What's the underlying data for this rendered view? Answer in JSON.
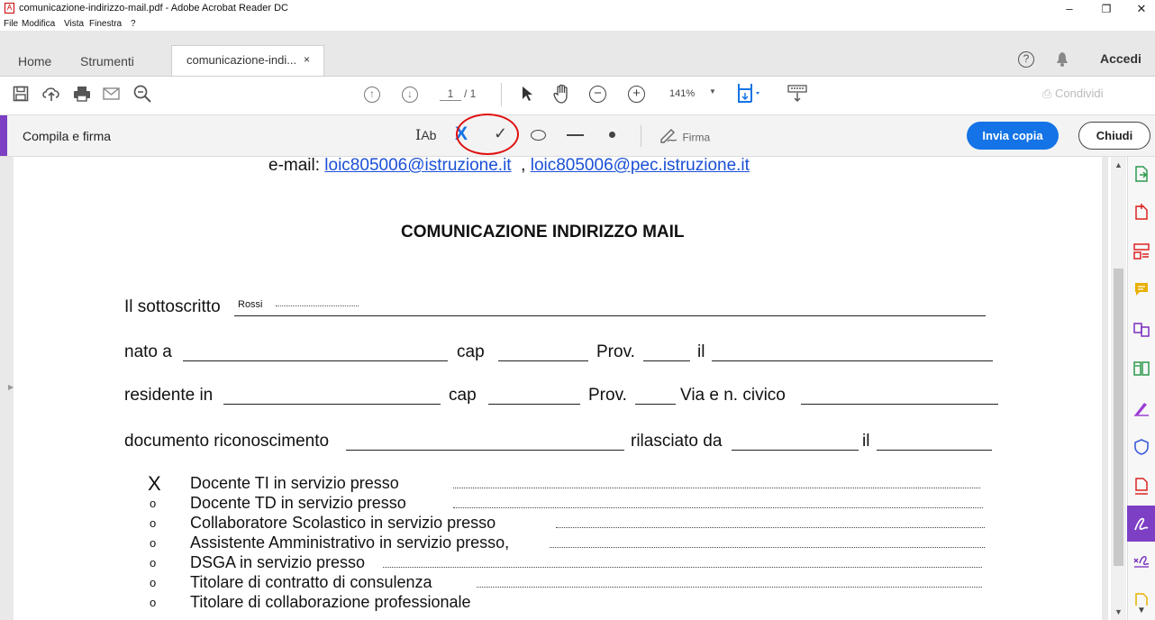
{
  "window": {
    "title": "comunicazione-indirizzo-mail.pdf - Adobe Acrobat Reader DC",
    "controls": [
      "–",
      "❐",
      "✕"
    ]
  },
  "menu": [
    "File",
    "Modifica",
    "Vista",
    "Finestra",
    "?"
  ],
  "tabs": {
    "home": "Home",
    "tools": "Strumenti",
    "doc": "comunicazione-indi...",
    "close": "×"
  },
  "header_right": {
    "help": "?",
    "signin": "Accedi"
  },
  "toolbar": {
    "page_current": "1",
    "page_total": "/ 1",
    "zoom": "141%",
    "share": "Condividi"
  },
  "fill_sign": {
    "title": "Compila e firma",
    "text_tool": "Ab",
    "cross_tool": "X",
    "check_tool": "✓",
    "sign_label": "Firma",
    "send_copy": "Invia copia",
    "close": "Chiudi"
  },
  "document": {
    "email_prefix": "e-mail:",
    "email1": "loic805006@istruzione.it",
    "email_sep": ",",
    "email2": "loic805006@pec.istruzione.it",
    "heading": "COMUNICAZIONE INDIRIZZO MAIL",
    "sottoscritto_label": "Il sottoscritto",
    "sottoscritto_value": "Rossi",
    "nato_a": "nato a",
    "cap": "cap",
    "prov": "Prov.",
    "il": "il",
    "residente_in": "residente in",
    "via": "Via e n. civico",
    "documento": "documento riconoscimento",
    "rilasciato": "rilasciato da",
    "options": [
      {
        "mark": "X",
        "text": "Docente TI in servizio presso"
      },
      {
        "mark": "o",
        "text": "Docente TD in servizio presso"
      },
      {
        "mark": "o",
        "text": "Collaboratore Scolastico in servizio presso"
      },
      {
        "mark": "o",
        "text": "Assistente Amministrativo in servizio presso,"
      },
      {
        "mark": "o",
        "text": "DSGA in servizio presso"
      },
      {
        "mark": "o",
        "text": "Titolare di contratto di consulenza"
      },
      {
        "mark": "o",
        "text": "Titolare di collaborazione professionale"
      }
    ]
  },
  "colors": {
    "accent": "#7d3fc4",
    "primary_button": "#1473e6",
    "highlight_circle": "#e01010",
    "link": "#1a4fd6"
  }
}
